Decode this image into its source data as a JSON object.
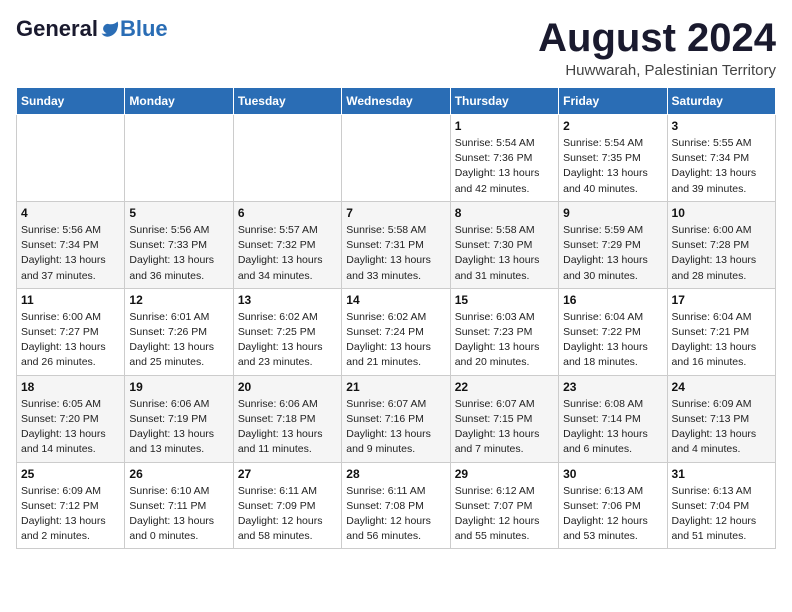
{
  "header": {
    "logo_general": "General",
    "logo_blue": "Blue",
    "month_title": "August 2024",
    "location": "Huwwarah, Palestinian Territory"
  },
  "weekdays": [
    "Sunday",
    "Monday",
    "Tuesday",
    "Wednesday",
    "Thursday",
    "Friday",
    "Saturday"
  ],
  "weeks": [
    [
      {
        "day": "",
        "detail": ""
      },
      {
        "day": "",
        "detail": ""
      },
      {
        "day": "",
        "detail": ""
      },
      {
        "day": "",
        "detail": ""
      },
      {
        "day": "1",
        "detail": "Sunrise: 5:54 AM\nSunset: 7:36 PM\nDaylight: 13 hours\nand 42 minutes."
      },
      {
        "day": "2",
        "detail": "Sunrise: 5:54 AM\nSunset: 7:35 PM\nDaylight: 13 hours\nand 40 minutes."
      },
      {
        "day": "3",
        "detail": "Sunrise: 5:55 AM\nSunset: 7:34 PM\nDaylight: 13 hours\nand 39 minutes."
      }
    ],
    [
      {
        "day": "4",
        "detail": "Sunrise: 5:56 AM\nSunset: 7:34 PM\nDaylight: 13 hours\nand 37 minutes."
      },
      {
        "day": "5",
        "detail": "Sunrise: 5:56 AM\nSunset: 7:33 PM\nDaylight: 13 hours\nand 36 minutes."
      },
      {
        "day": "6",
        "detail": "Sunrise: 5:57 AM\nSunset: 7:32 PM\nDaylight: 13 hours\nand 34 minutes."
      },
      {
        "day": "7",
        "detail": "Sunrise: 5:58 AM\nSunset: 7:31 PM\nDaylight: 13 hours\nand 33 minutes."
      },
      {
        "day": "8",
        "detail": "Sunrise: 5:58 AM\nSunset: 7:30 PM\nDaylight: 13 hours\nand 31 minutes."
      },
      {
        "day": "9",
        "detail": "Sunrise: 5:59 AM\nSunset: 7:29 PM\nDaylight: 13 hours\nand 30 minutes."
      },
      {
        "day": "10",
        "detail": "Sunrise: 6:00 AM\nSunset: 7:28 PM\nDaylight: 13 hours\nand 28 minutes."
      }
    ],
    [
      {
        "day": "11",
        "detail": "Sunrise: 6:00 AM\nSunset: 7:27 PM\nDaylight: 13 hours\nand 26 minutes."
      },
      {
        "day": "12",
        "detail": "Sunrise: 6:01 AM\nSunset: 7:26 PM\nDaylight: 13 hours\nand 25 minutes."
      },
      {
        "day": "13",
        "detail": "Sunrise: 6:02 AM\nSunset: 7:25 PM\nDaylight: 13 hours\nand 23 minutes."
      },
      {
        "day": "14",
        "detail": "Sunrise: 6:02 AM\nSunset: 7:24 PM\nDaylight: 13 hours\nand 21 minutes."
      },
      {
        "day": "15",
        "detail": "Sunrise: 6:03 AM\nSunset: 7:23 PM\nDaylight: 13 hours\nand 20 minutes."
      },
      {
        "day": "16",
        "detail": "Sunrise: 6:04 AM\nSunset: 7:22 PM\nDaylight: 13 hours\nand 18 minutes."
      },
      {
        "day": "17",
        "detail": "Sunrise: 6:04 AM\nSunset: 7:21 PM\nDaylight: 13 hours\nand 16 minutes."
      }
    ],
    [
      {
        "day": "18",
        "detail": "Sunrise: 6:05 AM\nSunset: 7:20 PM\nDaylight: 13 hours\nand 14 minutes."
      },
      {
        "day": "19",
        "detail": "Sunrise: 6:06 AM\nSunset: 7:19 PM\nDaylight: 13 hours\nand 13 minutes."
      },
      {
        "day": "20",
        "detail": "Sunrise: 6:06 AM\nSunset: 7:18 PM\nDaylight: 13 hours\nand 11 minutes."
      },
      {
        "day": "21",
        "detail": "Sunrise: 6:07 AM\nSunset: 7:16 PM\nDaylight: 13 hours\nand 9 minutes."
      },
      {
        "day": "22",
        "detail": "Sunrise: 6:07 AM\nSunset: 7:15 PM\nDaylight: 13 hours\nand 7 minutes."
      },
      {
        "day": "23",
        "detail": "Sunrise: 6:08 AM\nSunset: 7:14 PM\nDaylight: 13 hours\nand 6 minutes."
      },
      {
        "day": "24",
        "detail": "Sunrise: 6:09 AM\nSunset: 7:13 PM\nDaylight: 13 hours\nand 4 minutes."
      }
    ],
    [
      {
        "day": "25",
        "detail": "Sunrise: 6:09 AM\nSunset: 7:12 PM\nDaylight: 13 hours\nand 2 minutes."
      },
      {
        "day": "26",
        "detail": "Sunrise: 6:10 AM\nSunset: 7:11 PM\nDaylight: 13 hours\nand 0 minutes."
      },
      {
        "day": "27",
        "detail": "Sunrise: 6:11 AM\nSunset: 7:09 PM\nDaylight: 12 hours\nand 58 minutes."
      },
      {
        "day": "28",
        "detail": "Sunrise: 6:11 AM\nSunset: 7:08 PM\nDaylight: 12 hours\nand 56 minutes."
      },
      {
        "day": "29",
        "detail": "Sunrise: 6:12 AM\nSunset: 7:07 PM\nDaylight: 12 hours\nand 55 minutes."
      },
      {
        "day": "30",
        "detail": "Sunrise: 6:13 AM\nSunset: 7:06 PM\nDaylight: 12 hours\nand 53 minutes."
      },
      {
        "day": "31",
        "detail": "Sunrise: 6:13 AM\nSunset: 7:04 PM\nDaylight: 12 hours\nand 51 minutes."
      }
    ]
  ]
}
